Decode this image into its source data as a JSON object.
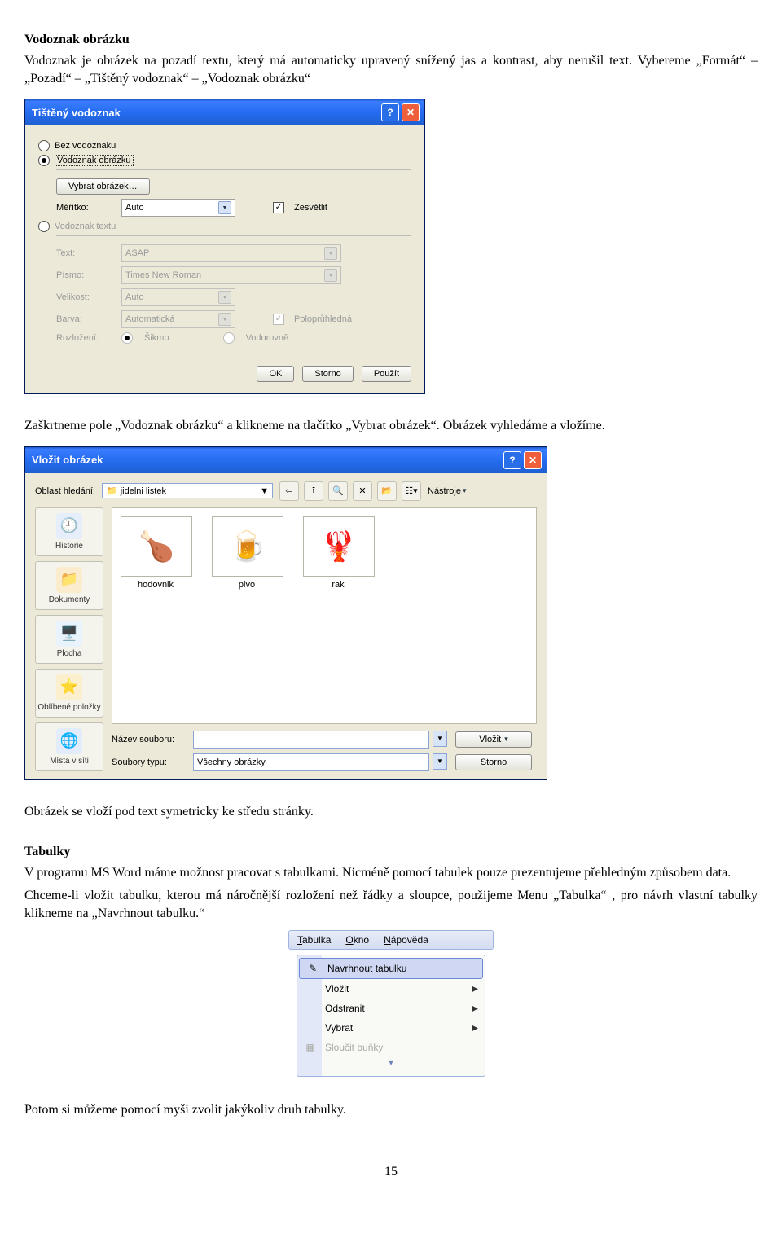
{
  "doc": {
    "heading1": "Vodoznak obrázku",
    "para1": "Vodoznak je obrázek na pozadí textu, který má automaticky upravený snížený jas a kontrast, aby nerušil text. Vybereme „Formát“ – „Pozadí“ – „Tištěný vodoznak“ – „Vodoznak obrázku“",
    "para2": "Zaškrtneme pole „Vodoznak obrázku“ a klikneme na tlačítko „Vybrat obrázek“. Obrázek vyhledáme a vložíme.",
    "para3": "Obrázek se vloží pod text symetricky ke středu stránky.",
    "heading2": "Tabulky",
    "para4": "V programu MS Word máme možnost pracovat s tabulkami. Nicméně pomocí tabulek pouze prezentujeme přehledným způsobem data.",
    "para5": "Chceme-li vložit tabulku, kterou má náročnější rozložení než řádky a sloupce, použijeme Menu „Tabulka“ , pro návrh vlastní tabulky klikneme na „Navrhnout tabulku.“",
    "para6": "Potom si můžeme pomocí myši zvolit jakýkoliv druh tabulky.",
    "page_number": "15"
  },
  "dialog1": {
    "title": "Tištěný vodoznak",
    "r_no": "Bez vodoznaku",
    "r_img": "Vodoznak obrázku",
    "btn_select_img": "Vybrat obrázek…",
    "lbl_scale": "Měřítko:",
    "scale_value": "Auto",
    "chk_light": "Zesvětlit",
    "r_text": "Vodoznak textu",
    "lbl_text": "Text:",
    "text_value": "ASAP",
    "lbl_font": "Písmo:",
    "font_value": "Times New Roman",
    "lbl_size": "Velikost:",
    "size_value": "Auto",
    "lbl_color": "Barva:",
    "color_value": "Automatická",
    "chk_semi": "Poloprůhledná",
    "lbl_layout": "Rozložení:",
    "r_diag": "Šikmo",
    "r_horiz": "Vodorovně",
    "btn_ok": "OK",
    "btn_cancel": "Storno",
    "btn_apply": "Použít"
  },
  "dialog2": {
    "title": "Vložit obrázek",
    "lbl_lookin": "Oblast hledání:",
    "folder": "jidelni listek",
    "tools": "Nástroje",
    "places": [
      "Historie",
      "Dokumenty",
      "Plocha",
      "Oblíbené položky",
      "Místa v síti"
    ],
    "thumbs": [
      {
        "name": "hodovnik",
        "glyph": "🍗"
      },
      {
        "name": "pivo",
        "glyph": "🍺"
      },
      {
        "name": "rak",
        "glyph": "🦞"
      }
    ],
    "lbl_filename": "Název souboru:",
    "lbl_filetype": "Soubory typu:",
    "filetype": "Všechny obrázky",
    "btn_insert": "Vložit",
    "btn_cancel": "Storno"
  },
  "menu": {
    "top": [
      "Tabulka",
      "Okno",
      "Nápověda"
    ],
    "item1": "Navrhnout tabulku",
    "item2": "Vložit",
    "item3": "Odstranit",
    "item4": "Vybrat",
    "item5": "Sloučit buňky"
  }
}
